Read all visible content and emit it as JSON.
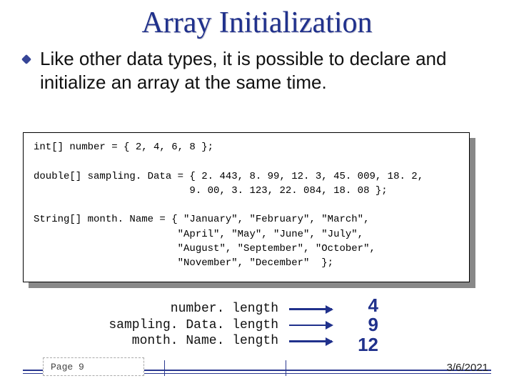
{
  "title": "Array Initialization",
  "bullet_text": "Like other data types, it is possible to declare and initialize an array at the same time.",
  "code": "int[] number = { 2, 4, 6, 8 };\n\ndouble[] sampling. Data = { 2. 443, 8. 99, 12. 3, 45. 009, 18. 2,\n                          9. 00, 3. 123, 22. 084, 18. 08 };\n\nString[] month. Name = { \"January\", \"February\", \"March\",\n                        \"April\", \"May\", \"June\", \"July\",\n                        \"August\", \"September\", \"October\",\n                        \"November\", \"December\"  };",
  "lengths": {
    "labels": "number. length\nsampling. Data. length\nmonth. Name. length",
    "values": "4\n9\n12"
  },
  "footer": {
    "page": "Page 9",
    "date": "3/6/2021"
  }
}
